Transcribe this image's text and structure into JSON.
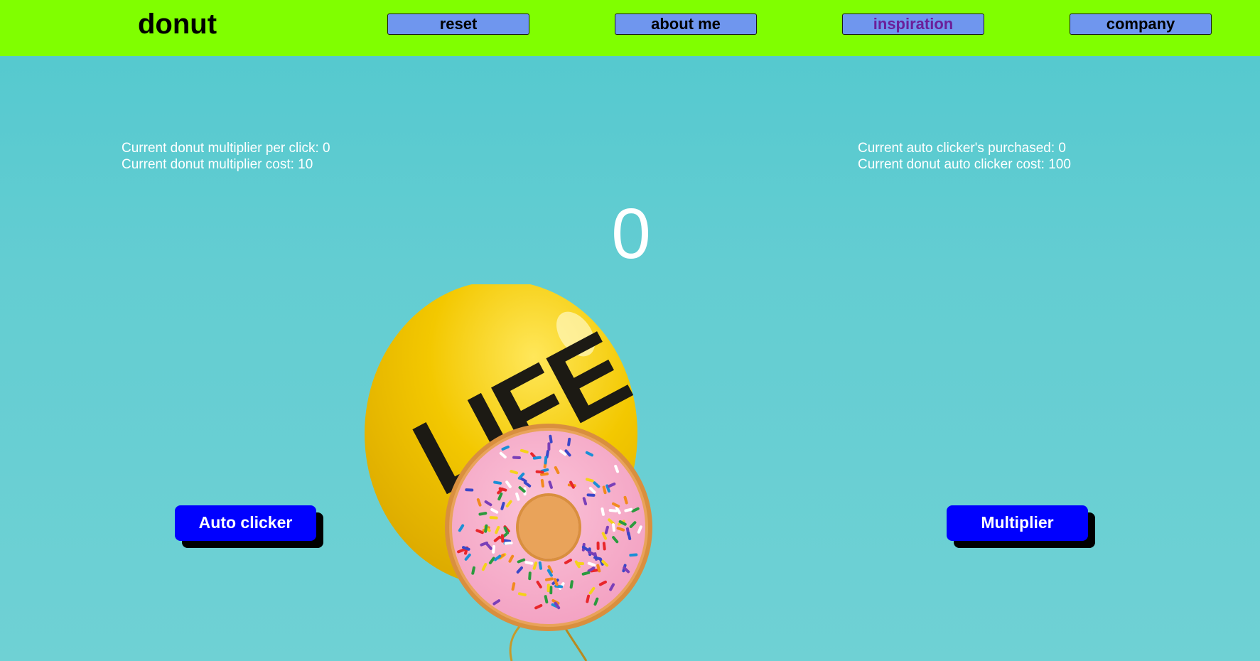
{
  "header": {
    "brand": "donut",
    "nav": [
      {
        "label": "reset"
      },
      {
        "label": "about me"
      },
      {
        "label": "inspiration"
      },
      {
        "label": "company"
      }
    ]
  },
  "stats": {
    "multiplier_per_click": "Current donut multiplier per click: 0",
    "multiplier_cost": "Current donut multiplier cost: 10",
    "auto_clickers_purchased": "Current auto clicker's purchased: 0",
    "auto_clicker_cost": "Current donut auto clicker cost: 100"
  },
  "counter": "0",
  "buttons": {
    "auto_clicker": "Auto clicker",
    "multiplier": "Multiplier"
  },
  "image": {
    "balloon_text": "LIFE"
  },
  "colors": {
    "navbar": "#80ff00",
    "nav_button": "#6f96ee",
    "visited_link": "#6b1f9a",
    "background": "#5fcbd0",
    "action_button": "#0000ff",
    "action_shadow": "#000000",
    "balloon": "#f2c500",
    "donut_frosting": "#f7a8c8"
  }
}
